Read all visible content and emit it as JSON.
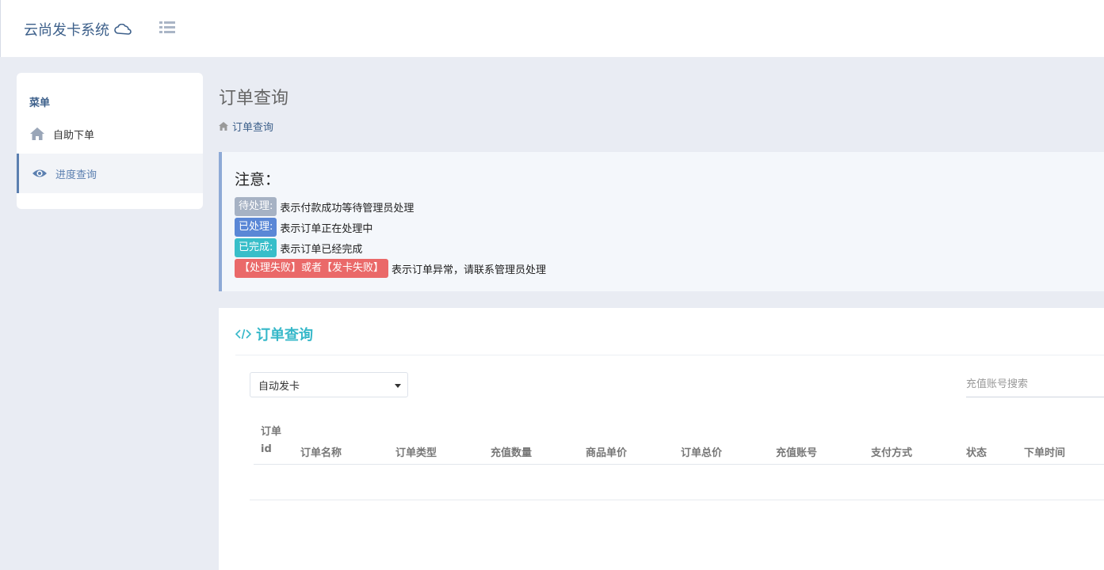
{
  "app": {
    "title": "云尚发卡系统"
  },
  "sidebar": {
    "heading": "菜单",
    "items": [
      {
        "label": "自助下单",
        "icon": "home-icon"
      },
      {
        "label": "进度查询",
        "icon": "eye-icon",
        "active": true
      }
    ]
  },
  "page": {
    "title": "订单查询",
    "breadcrumb": "订单查询"
  },
  "notice": {
    "title": "注意：",
    "rows": [
      {
        "badge": "待处理:",
        "text": "表示付款成功等待管理员处理",
        "color": "#a6b2c4"
      },
      {
        "badge": "已处理:",
        "text": "表示订单正在处理中",
        "color": "#5a87d6"
      },
      {
        "badge": "已完成:",
        "text": "表示订单已经完成",
        "color": "#38bec9"
      },
      {
        "badge": "【处理失败】或者【发卡失败】",
        "text": "表示订单异常，请联系管理员处理",
        "color": "#ea6969"
      }
    ]
  },
  "panel": {
    "title": "订单查询",
    "select_value": "自动发卡",
    "search_placeholder": "充值账号搜索",
    "columns": [
      "订单id",
      "订单名称",
      "订单类型",
      "充值数量",
      "商品单价",
      "订单总价",
      "充值账号",
      "支付方式",
      "状态",
      "下单时间"
    ]
  }
}
